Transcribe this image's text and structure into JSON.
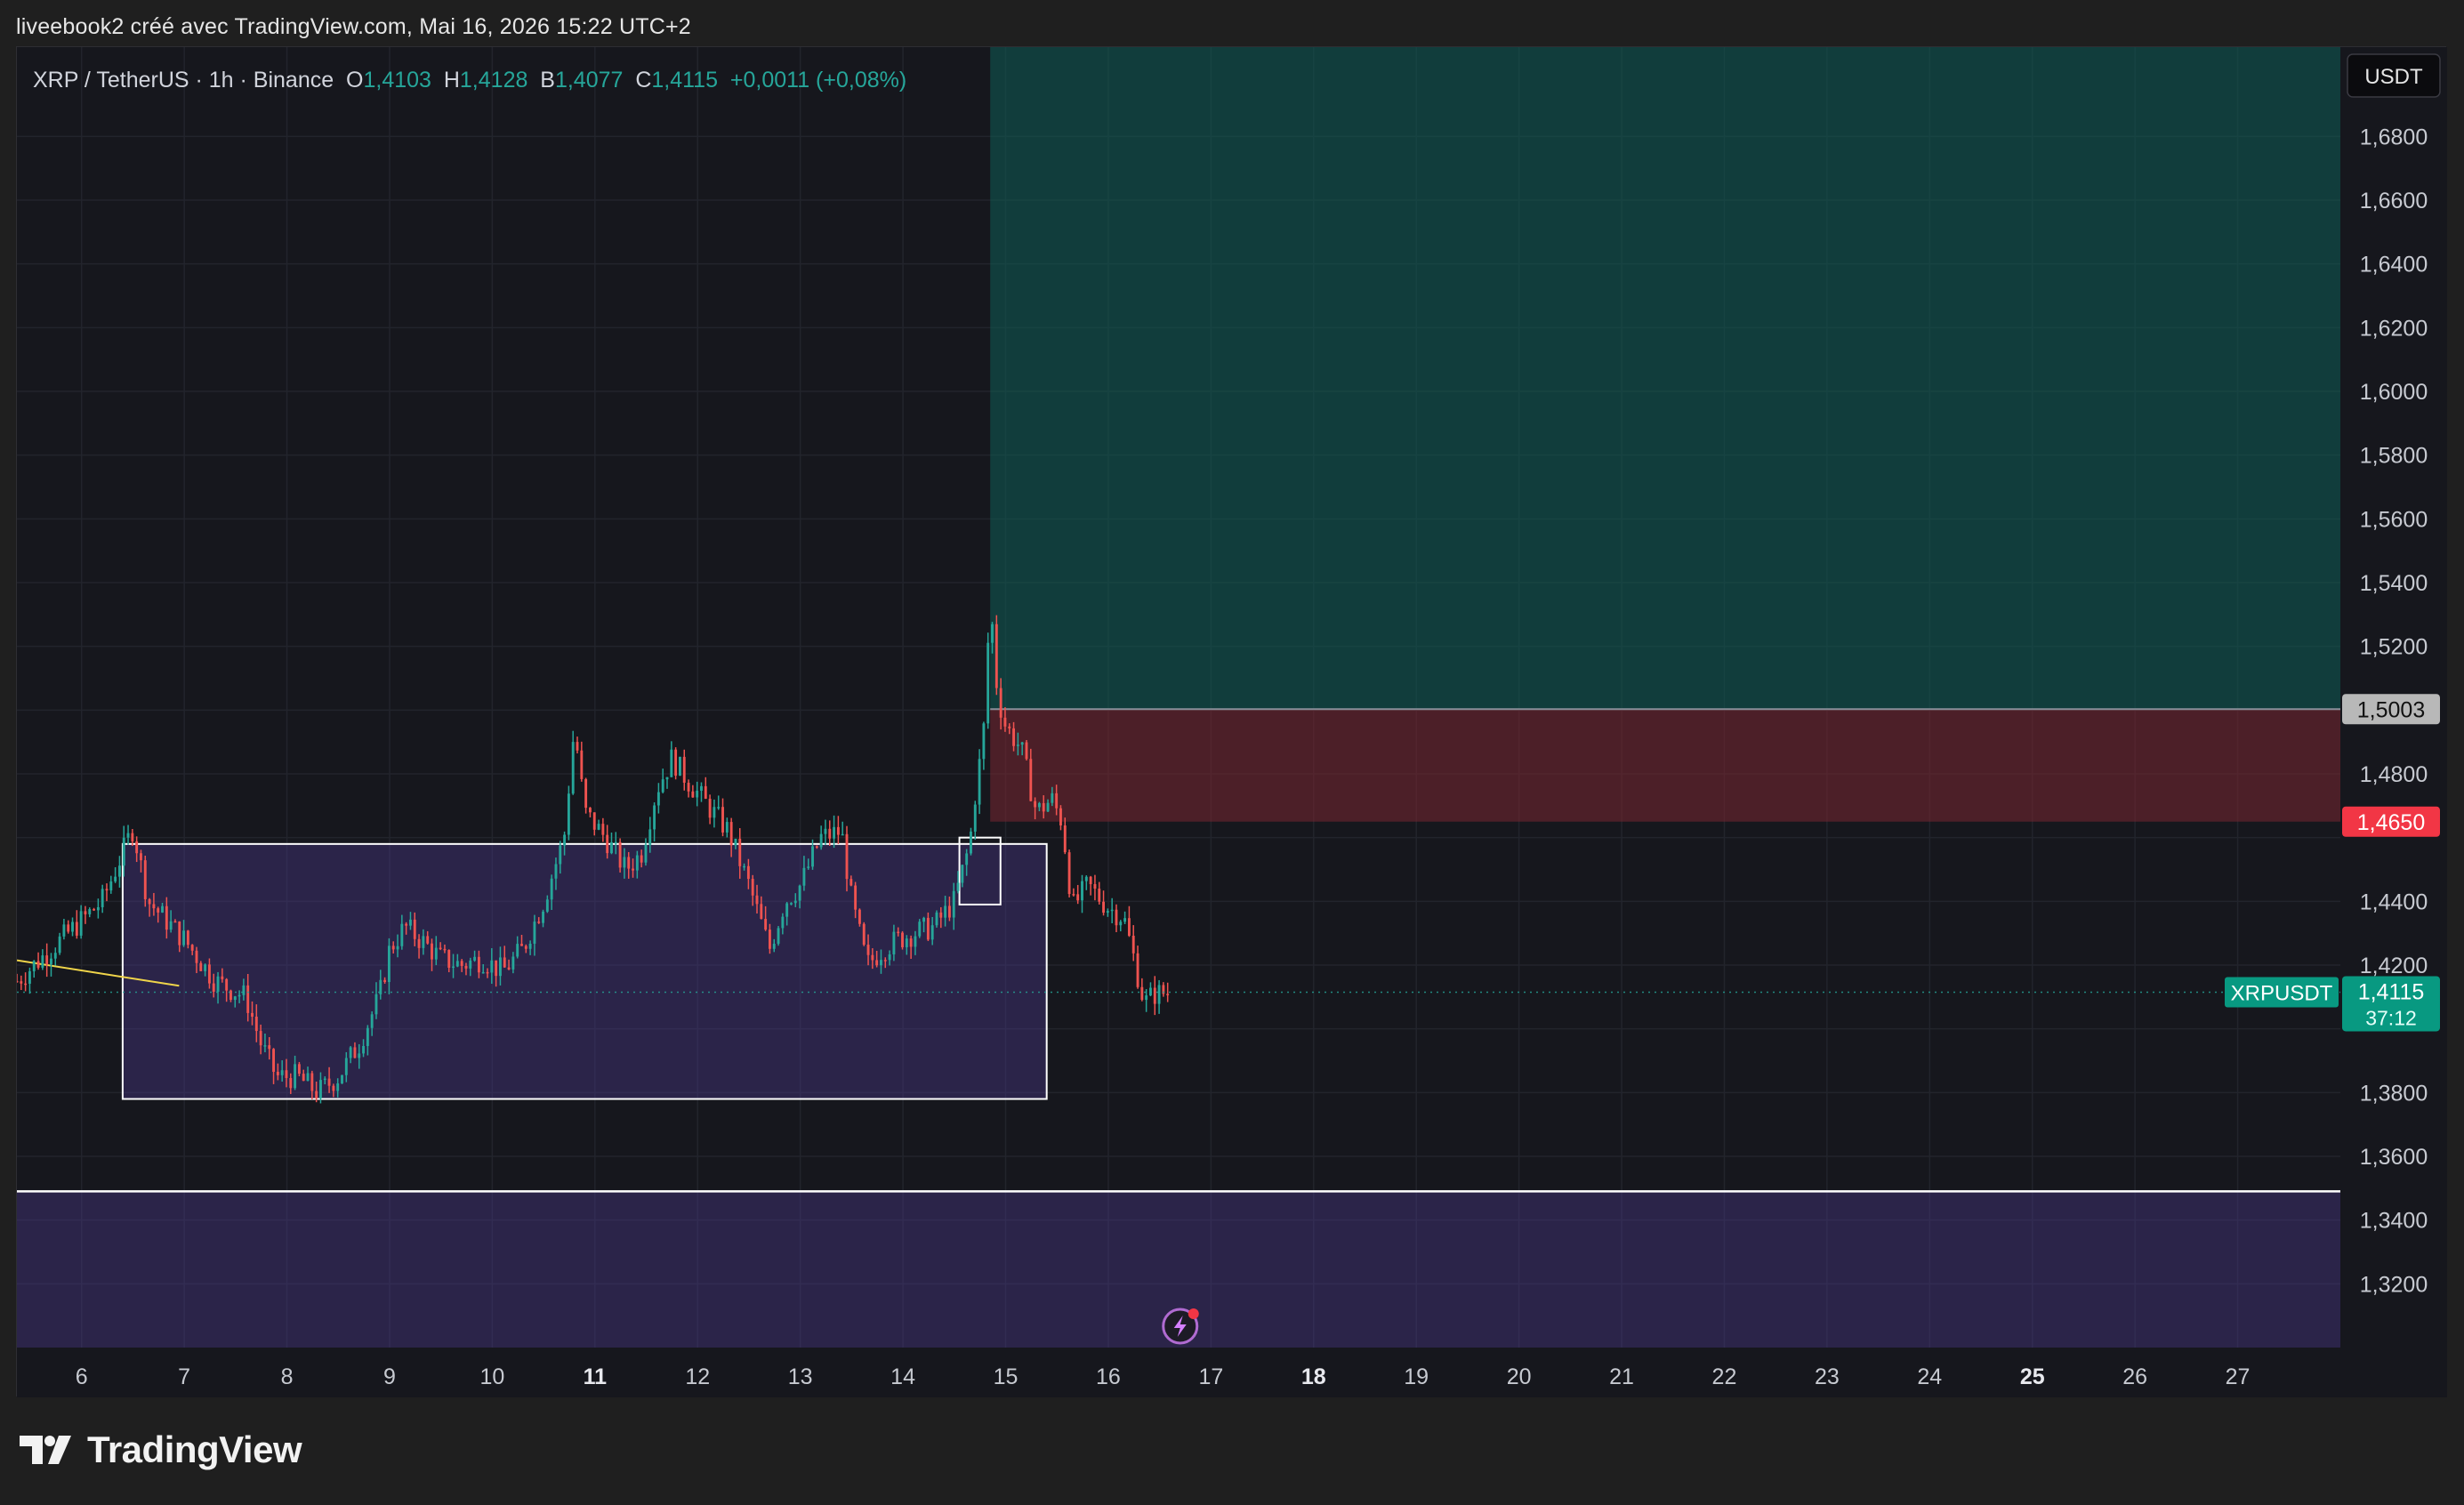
{
  "header": {
    "caption": "liveebook2 créé avec TradingView.com, Mai 16, 2026 15:22 UTC+2"
  },
  "legend": {
    "symbol": "XRP / TetherUS · 1h · Binance",
    "o_label": "O",
    "o_value": "1,4103",
    "h_label": "H",
    "h_value": "1,4128",
    "b_label": "B",
    "b_value": "1,4077",
    "c_label": "C",
    "c_value": "1,4115",
    "change": "+0,0011 (+0,08%)"
  },
  "currency_button": "USDT",
  "footer": {
    "brand": "TradingView"
  },
  "colors": {
    "up": "#26a69a",
    "down": "#ef5350",
    "accent_green": "#089981",
    "stop_red": "#f23645",
    "zone_purple": "#4b3a8c",
    "profit_teal": "#0f5c55"
  },
  "chart_data": {
    "type": "candlestick",
    "symbol": "XRPUSDT",
    "timeframe": "1h",
    "y_axis": {
      "ticks": [
        "1,6800",
        "1,6600",
        "1,6400",
        "1,6200",
        "1,6000",
        "1,5800",
        "1,5600",
        "1,5400",
        "1,5200",
        "1,4800",
        "1,4400",
        "1,4200",
        "1,3800",
        "1,3600",
        "1,3400",
        "1,3200"
      ],
      "range": [
        1.3,
        1.708
      ]
    },
    "x_axis": {
      "ticks": [
        "6",
        "7",
        "8",
        "9",
        "10",
        "11",
        "12",
        "13",
        "14",
        "15",
        "16",
        "17",
        "18",
        "19",
        "20",
        "21",
        "22",
        "23",
        "24",
        "25",
        "26",
        "27"
      ],
      "bold_ticks": [
        "11",
        "18",
        "25"
      ],
      "range_days": [
        5.37,
        28.0
      ]
    },
    "series_close_path": [
      [
        5.37,
        1.415
      ],
      [
        5.8,
        1.428
      ],
      [
        6.2,
        1.44
      ],
      [
        6.5,
        1.463
      ],
      [
        6.65,
        1.44
      ],
      [
        7.0,
        1.428
      ],
      [
        7.3,
        1.415
      ],
      [
        7.6,
        1.41
      ],
      [
        7.75,
        1.395
      ],
      [
        7.9,
        1.385
      ],
      [
        8.1,
        1.385
      ],
      [
        8.3,
        1.38
      ],
      [
        8.5,
        1.385
      ],
      [
        8.7,
        1.395
      ],
      [
        8.9,
        1.41
      ],
      [
        9.0,
        1.425
      ],
      [
        9.15,
        1.432
      ],
      [
        9.3,
        1.428
      ],
      [
        9.5,
        1.422
      ],
      [
        9.7,
        1.42
      ],
      [
        9.9,
        1.422
      ],
      [
        10.1,
        1.418
      ],
      [
        10.3,
        1.425
      ],
      [
        10.5,
        1.44
      ],
      [
        10.7,
        1.46
      ],
      [
        10.8,
        1.495
      ],
      [
        10.9,
        1.468
      ],
      [
        11.1,
        1.46
      ],
      [
        11.3,
        1.45
      ],
      [
        11.45,
        1.455
      ],
      [
        11.6,
        1.475
      ],
      [
        11.75,
        1.485
      ],
      [
        11.9,
        1.478
      ],
      [
        12.1,
        1.47
      ],
      [
        12.3,
        1.462
      ],
      [
        12.5,
        1.445
      ],
      [
        12.7,
        1.425
      ],
      [
        12.85,
        1.44
      ],
      [
        13.0,
        1.445
      ],
      [
        13.2,
        1.46
      ],
      [
        13.4,
        1.462
      ],
      [
        13.5,
        1.44
      ],
      [
        13.65,
        1.42
      ],
      [
        13.8,
        1.425
      ],
      [
        13.95,
        1.428
      ],
      [
        14.1,
        1.43
      ],
      [
        14.3,
        1.432
      ],
      [
        14.5,
        1.44
      ],
      [
        14.65,
        1.458
      ],
      [
        14.72,
        1.478
      ],
      [
        14.78,
        1.49
      ],
      [
        14.85,
        1.535
      ],
      [
        14.92,
        1.505
      ],
      [
        15.0,
        1.495
      ],
      [
        15.15,
        1.488
      ],
      [
        15.3,
        1.468
      ],
      [
        15.45,
        1.472
      ],
      [
        15.55,
        1.465
      ],
      [
        15.65,
        1.438
      ],
      [
        15.8,
        1.445
      ],
      [
        16.0,
        1.438
      ],
      [
        16.15,
        1.435
      ],
      [
        16.25,
        1.422
      ],
      [
        16.35,
        1.408
      ],
      [
        16.45,
        1.411
      ],
      [
        16.6,
        1.4115
      ]
    ],
    "last_price": "1,4115",
    "last_price_tag": "XRPUSDT",
    "countdown": "37:12",
    "levels": {
      "entry_label": "1,5003",
      "entry": 1.5003,
      "stop_label": "1,4650",
      "stop": 1.465,
      "target": 1.708
    },
    "zones": [
      {
        "name": "range",
        "from_day": 6.4,
        "to_day": 15.4,
        "low": 1.378,
        "high": 1.458
      },
      {
        "name": "lower-zone",
        "from_day": 5.37,
        "to_day": 28.0,
        "low": 1.3,
        "high": 1.349
      }
    ]
  }
}
